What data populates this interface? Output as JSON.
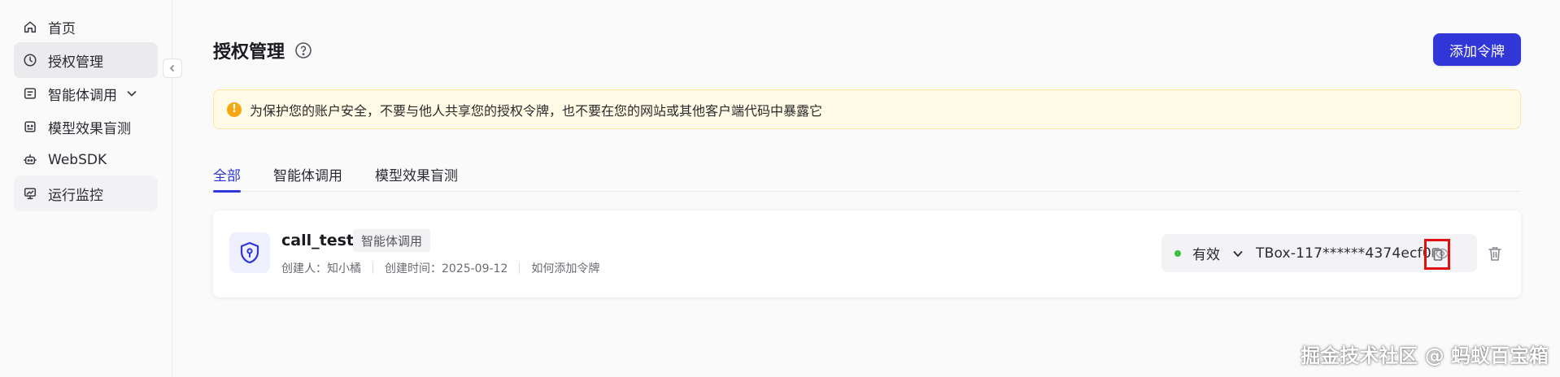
{
  "sidebar": {
    "items": [
      {
        "label": "首页",
        "icon": "home-icon"
      },
      {
        "label": "授权管理",
        "icon": "clock-icon"
      },
      {
        "label": "智能体调用",
        "icon": "agent-icon"
      },
      {
        "label": "模型效果盲测",
        "icon": "robot-face-icon"
      },
      {
        "label": "WebSDK",
        "icon": "bot-icon"
      },
      {
        "label": "运行监控",
        "icon": "monitor-icon"
      }
    ]
  },
  "header": {
    "title": "授权管理",
    "add_button": "添加令牌"
  },
  "alert": {
    "text": "为保护您的账户安全，不要与他人共享您的授权令牌，也不要在您的网站或其他客户端代码中暴露它"
  },
  "tabs": [
    {
      "label": "全部"
    },
    {
      "label": "智能体调用"
    },
    {
      "label": "模型效果盲测"
    }
  ],
  "token": {
    "name": "call_test",
    "tag": "智能体调用",
    "creator": "创建人：知小橘",
    "created_time": "创建时间：2025-09-12",
    "how_to": "如何添加令牌",
    "status": "有效",
    "value": "TBox-117******4374ecf0"
  },
  "watermark": "掘金技术社区 @ 蚂蚁百宝箱",
  "colors": {
    "accent": "#3136d9",
    "status_ok": "#3cbf3c",
    "warning": "#f6a610",
    "highlight": "#e01010"
  }
}
